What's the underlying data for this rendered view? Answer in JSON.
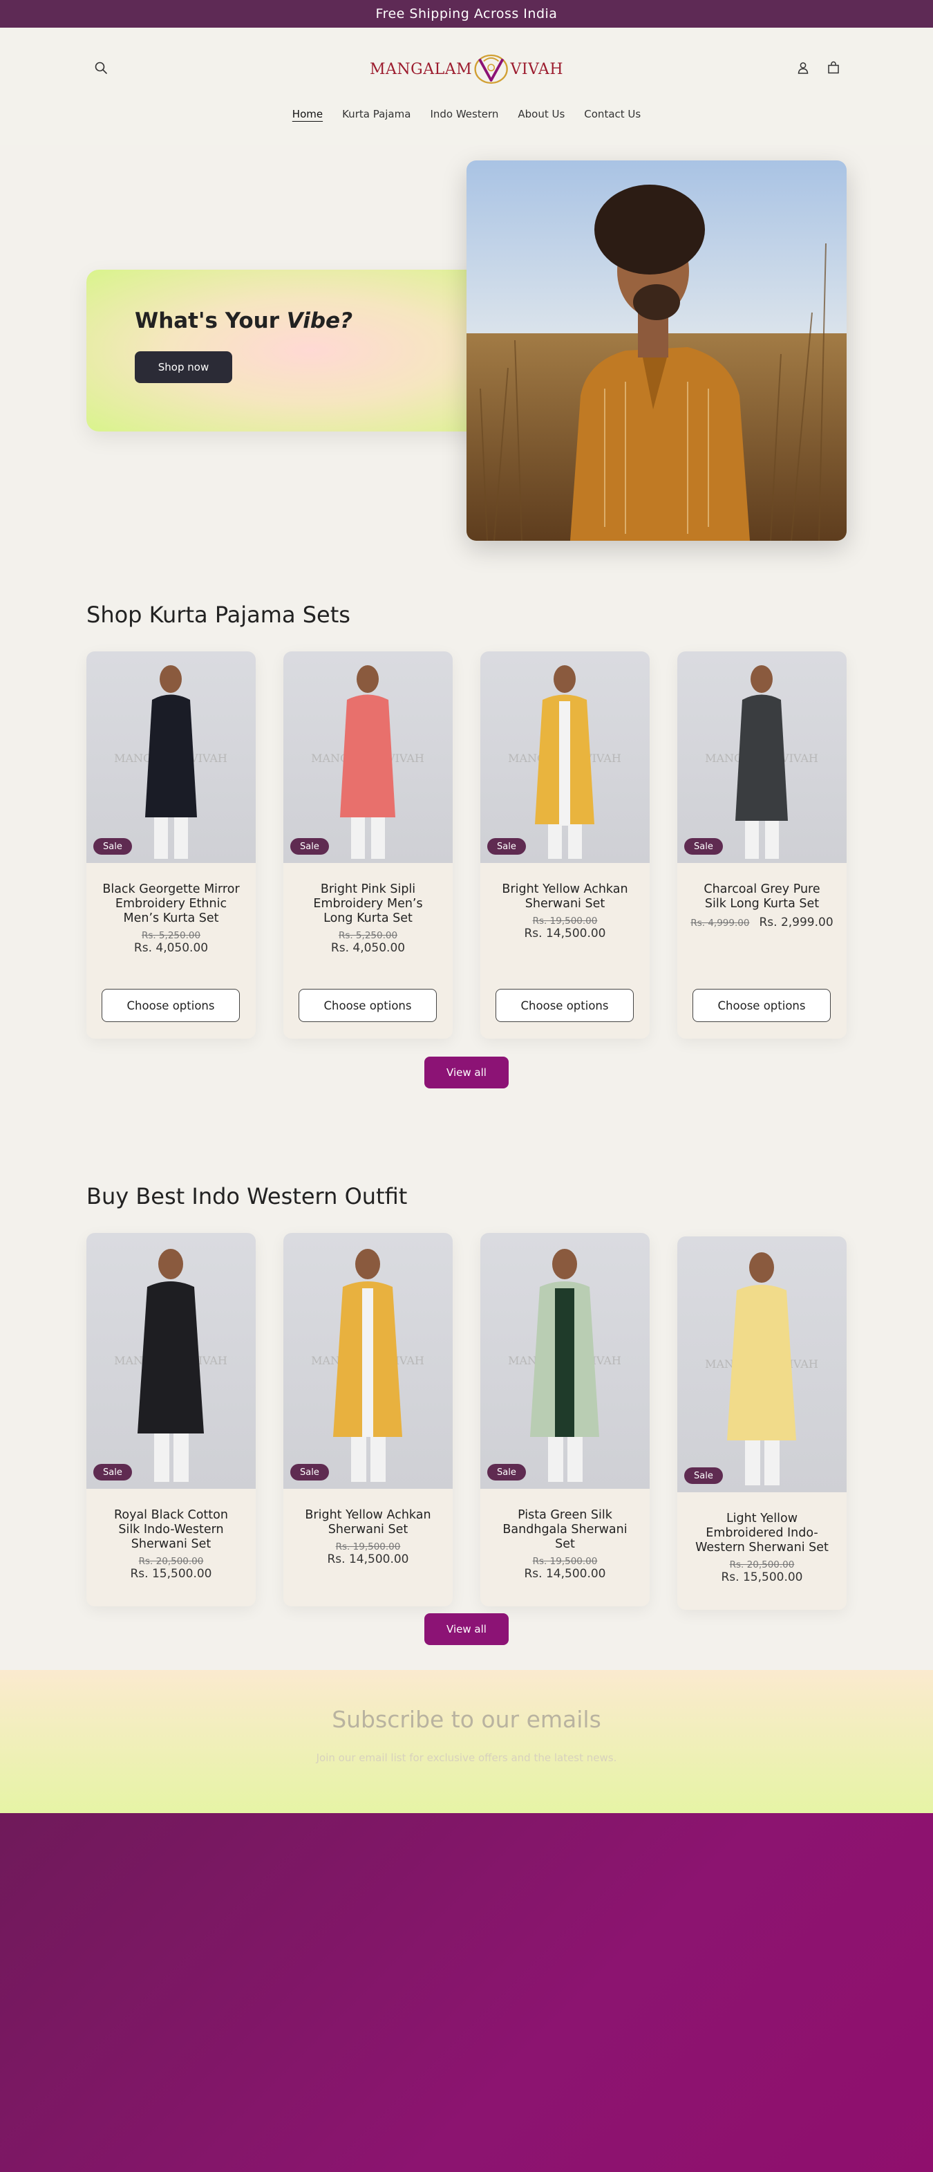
{
  "announcement": "Free Shipping Across India",
  "header": {
    "logo_left": "MANGALAM",
    "logo_right": "VIVAH",
    "nav": [
      {
        "label": "Home",
        "active": true
      },
      {
        "label": "Kurta Pajama"
      },
      {
        "label": "Indo Western"
      },
      {
        "label": "About Us"
      },
      {
        "label": "Contact Us"
      }
    ]
  },
  "hero": {
    "title_prefix": "What's Your ",
    "title_emphasis": "Vibe?",
    "button": "Shop now"
  },
  "kurta_section": {
    "title": "Shop Kurta Pajama Sets",
    "view_all": "View all",
    "products": [
      {
        "name": "Black Georgette Mirror Embroidery Ethnic Men’s Kurta Set",
        "badge": "Sale",
        "old_price": "Rs. 5,250.00",
        "price": "Rs. 4,050.00",
        "button": "Choose options",
        "color": "#1a1c26"
      },
      {
        "name": "Bright Pink Sipli Embroidery Men’s Long Kurta Set",
        "badge": "Sale",
        "old_price": "Rs. 5,250.00",
        "price": "Rs. 4,050.00",
        "button": "Choose options",
        "color": "#e8706c"
      },
      {
        "name": "Bright Yellow Achkan Sherwani Set",
        "badge": "Sale",
        "old_price": "Rs. 19,500.00",
        "price": "Rs. 14,500.00",
        "button": "Choose options",
        "color": "#e9b43e"
      },
      {
        "name": "Charcoal Grey Pure Silk Long Kurta Set",
        "badge": "Sale",
        "old_price": "Rs. 4,999.00",
        "price": "Rs. 2,999.00",
        "button": "Choose options",
        "color": "#3a3d40"
      }
    ]
  },
  "indo_section": {
    "title": "Buy Best Indo Western Outfit",
    "view_all": "View all",
    "products": [
      {
        "name": "Royal Black Cotton Silk Indo-Western Sherwani Set",
        "badge": "Sale",
        "old_price": "Rs. 20,500.00",
        "price": "Rs. 15,500.00",
        "color": "#1e1e22"
      },
      {
        "name": "Bright Yellow Achkan Sherwani Set",
        "badge": "Sale",
        "old_price": "Rs. 19,500.00",
        "price": "Rs. 14,500.00",
        "color": "#e8b13f"
      },
      {
        "name": "Pista Green Silk Bandhgala Sherwani Set",
        "badge": "Sale",
        "old_price": "Rs. 19,500.00",
        "price": "Rs. 14,500.00",
        "color": "#b9cdb3"
      },
      {
        "name": "Light Yellow Embroidered Indo-Western Sherwani Set",
        "badge": "Sale",
        "old_price": "Rs. 20,500.00",
        "price": "Rs. 15,500.00",
        "color": "#f1db8a"
      }
    ]
  },
  "newsletter": {
    "title": "Subscribe to our emails",
    "subtitle": "Join our email list for exclusive offers and the latest news."
  },
  "icons": {
    "search": "search-icon",
    "account": "account-icon",
    "cart": "cart-icon"
  },
  "colors": {
    "announcement_bg": "#5e2a55",
    "accent": "#8c1375",
    "footer_bg": "#8c1470"
  }
}
